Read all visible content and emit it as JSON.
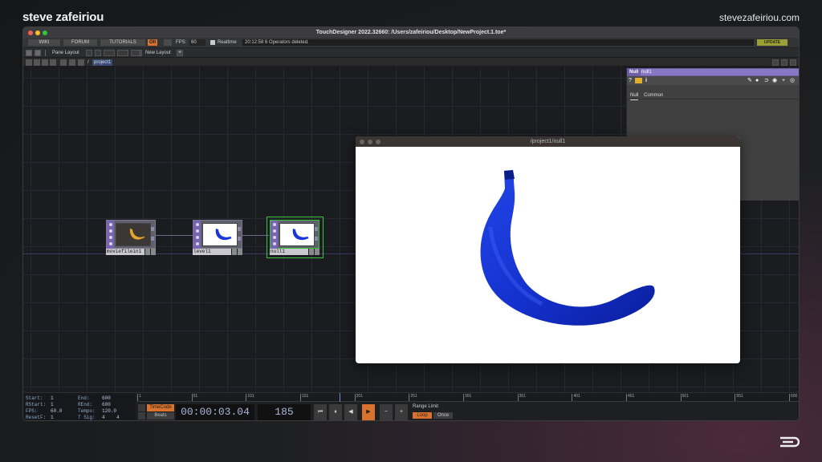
{
  "overlay": {
    "brand": "steve zafeiriou",
    "site": "stevezafeiriou.com"
  },
  "window": {
    "title": "TouchDesigner 2022.32660: /Users/zafeiriou/Desktop/NewProject.1.toe*"
  },
  "menubar": {
    "wiki": "WIKI",
    "forum": "FORUM",
    "tutorials": "TUTORIALS",
    "oi": "OII",
    "fps_label": "FPS:",
    "fps_value": "60",
    "realtime_label": "Realtime",
    "status": "20:12:58 6 Operators deleted.",
    "update": "UPDATE"
  },
  "layoutbar": {
    "pane_layout": "Pane Layout",
    "new_layout": "New Layout",
    "plus": "+"
  },
  "pathbar": {
    "crumb": "project1",
    "slash": "/"
  },
  "nodes": [
    {
      "label": "moviefilein1"
    },
    {
      "label": "level1"
    },
    {
      "label": "null1"
    }
  ],
  "params": {
    "type": "Null",
    "name": "null1",
    "tabs": [
      "Null",
      "Common"
    ],
    "tool_icons": [
      "help-icon",
      "python-icon",
      "info-icon",
      "edit-icon",
      "comment-icon",
      "link-icon",
      "viewer-icon",
      "plus-icon",
      "target-icon"
    ]
  },
  "viewer": {
    "title": "/project1/null1"
  },
  "stats": {
    "start_label": "Start:",
    "start": "1",
    "rstart_label": "RStart:",
    "rstart": "1",
    "fps_label": "FPS:",
    "fps": "60.0",
    "resetf_label": "ResetF:",
    "resetf": "1",
    "end_label": "End:",
    "end": "600",
    "rend_label": "REnd:",
    "rend": "600",
    "tempo_label": "Tempo:",
    "tempo": "120.0",
    "tsig_label": "T Sig:",
    "tsig_a": "4",
    "tsig_b": "4"
  },
  "ruler": {
    "ticks": [
      "1",
      "51",
      "101",
      "151",
      "201",
      "251",
      "301",
      "351",
      "401",
      "451",
      "501",
      "551",
      "600"
    ]
  },
  "transport": {
    "timecode_label": "TimeCode",
    "beats_label": "Beats",
    "timecode": "00:00:03.04",
    "frame": "185",
    "range_label": "Range Limit",
    "loop": "Loop",
    "once": "Once",
    "buttons": [
      "⏮",
      "⏸",
      "◀",
      "▶",
      "−",
      "+"
    ]
  },
  "colors": {
    "accent_orange": "#d9722d",
    "selected_green": "#3dc63d",
    "op_purple": "#7a63b3",
    "banana_blue": "#1a36d8"
  }
}
